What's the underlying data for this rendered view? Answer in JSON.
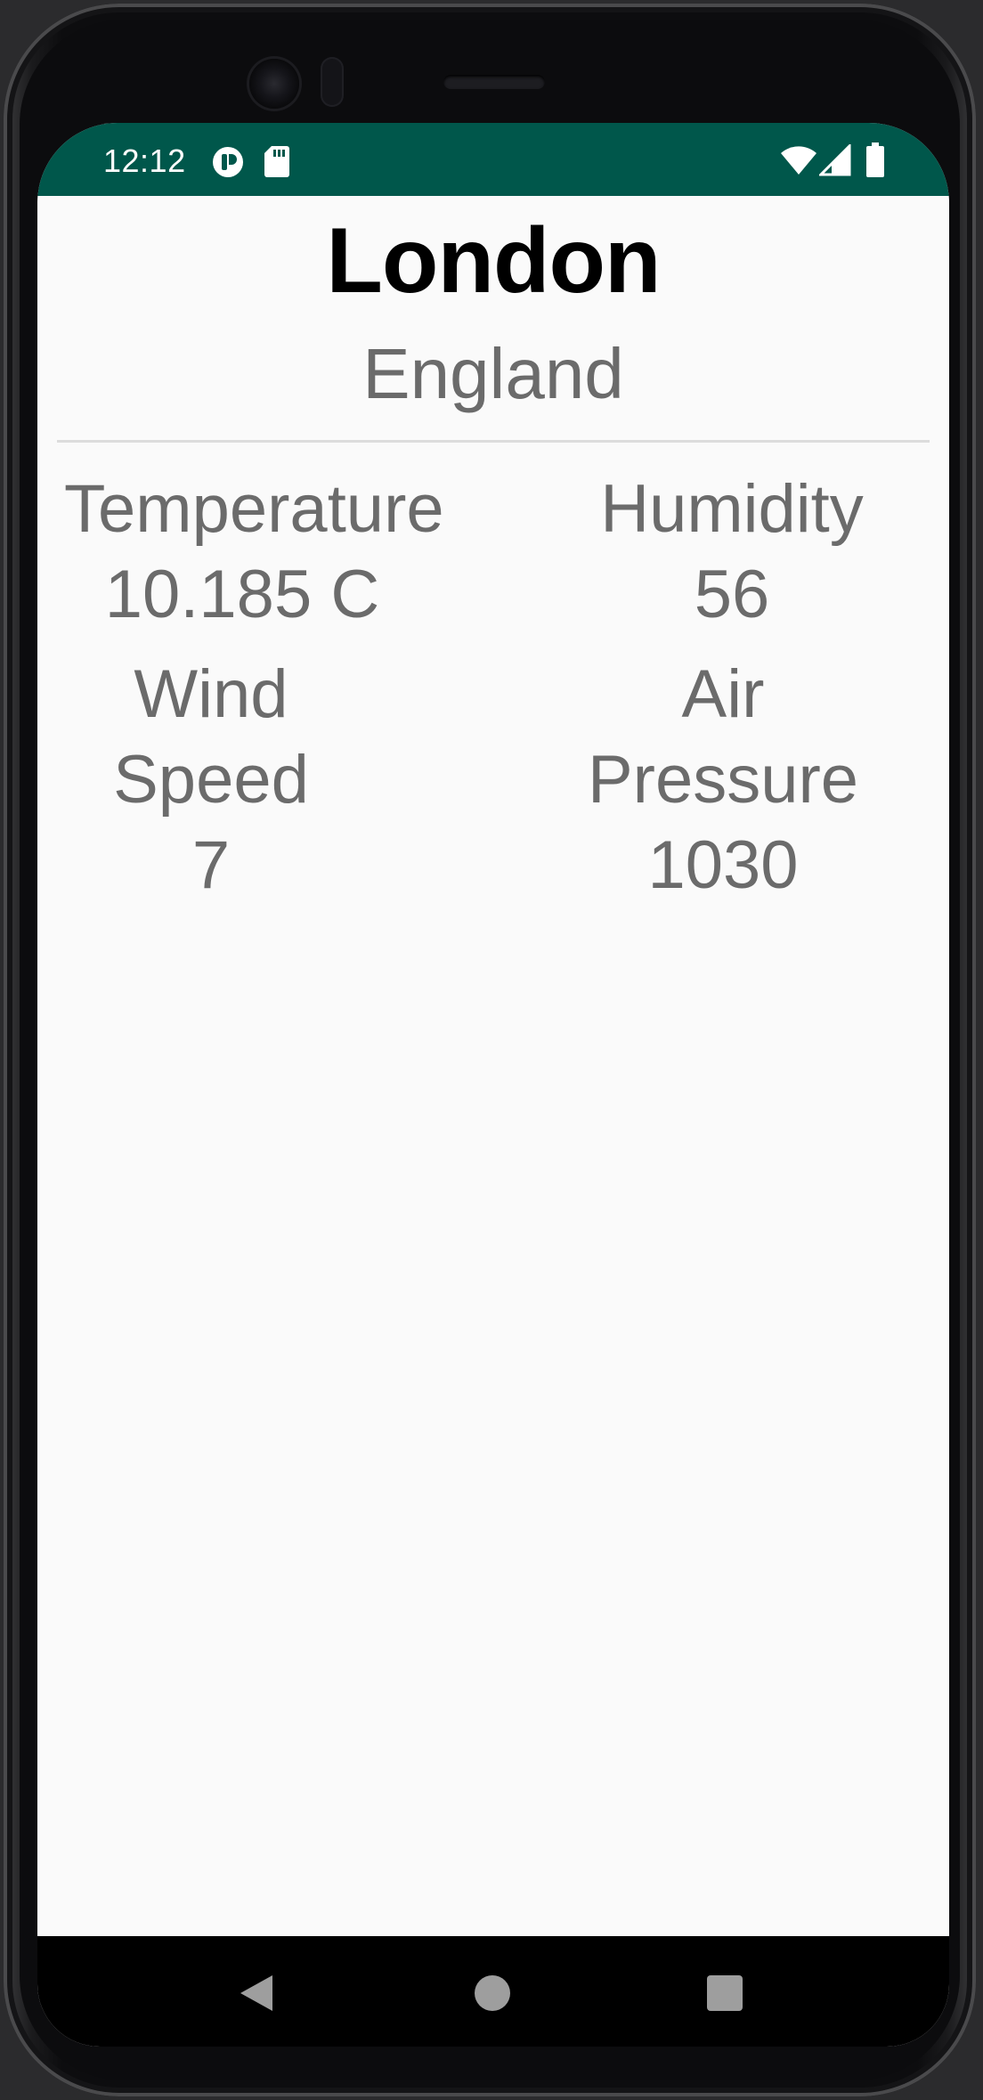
{
  "status_bar": {
    "time": "12:12",
    "left_icons": [
      "app-notification-icon",
      "sd-card-icon"
    ],
    "right_icons": [
      "wifi-icon",
      "cell-signal-icon",
      "battery-icon"
    ],
    "color": "#00574b"
  },
  "weather": {
    "city": "London",
    "country": "England",
    "temperature_label": "Temperature",
    "temperature_value": "10.185 C",
    "humidity_label": "Humidity",
    "humidity_value": "56",
    "wind_label": "Wind Speed",
    "wind_value": "7",
    "pressure_label_line1": "Air",
    "pressure_label_line2": "Pressure",
    "pressure_value": "1030"
  },
  "nav_bar": {
    "buttons": [
      "back-icon",
      "home-icon",
      "recents-icon"
    ]
  }
}
